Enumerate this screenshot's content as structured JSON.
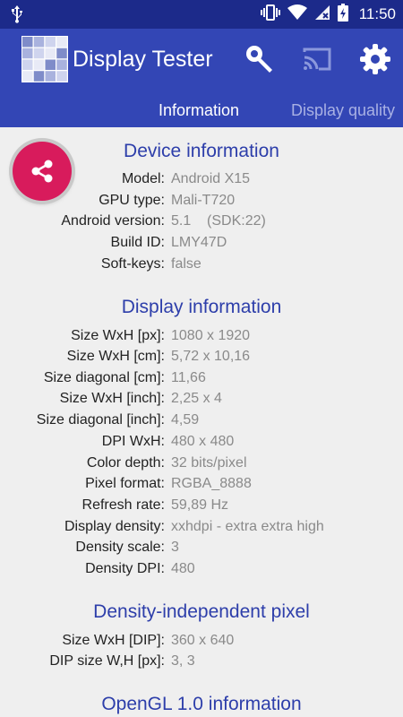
{
  "status_bar": {
    "time": "11:50",
    "icons": [
      "usb-icon",
      "vibrate-icon",
      "wifi-icon",
      "no-sim-icon",
      "battery-charging-icon"
    ]
  },
  "app": {
    "title": "Display Tester",
    "toolbar_icons": [
      "wrench-icon",
      "cast-icon",
      "settings-icon"
    ]
  },
  "tabs": [
    {
      "label": "Information",
      "active": true
    },
    {
      "label": "Display quality",
      "active": false
    }
  ],
  "share_button": {
    "icon": "share-icon",
    "color": "#d81b5c"
  },
  "sections": [
    {
      "title": "Device information",
      "rows": [
        {
          "label": "Model:",
          "value": "Android X15"
        },
        {
          "label": "GPU type:",
          "value": "Mali-T720"
        },
        {
          "label": "Android version:",
          "value": "5.1    (SDK:22)"
        },
        {
          "label": "Build ID:",
          "value": "LMY47D"
        },
        {
          "label": "Soft-keys:",
          "value": "false"
        }
      ]
    },
    {
      "title": "Display information",
      "rows": [
        {
          "label": "Size WxH [px]:",
          "value": "1080 x 1920"
        },
        {
          "label": "Size WxH [cm]:",
          "value": "5,72 x 10,16"
        },
        {
          "label": "Size diagonal [cm]:",
          "value": "11,66"
        },
        {
          "label": "Size WxH [inch]:",
          "value": "2,25 x 4"
        },
        {
          "label": "Size diagonal [inch]:",
          "value": "4,59"
        },
        {
          "label": "DPI WxH:",
          "value": "480 x 480"
        },
        {
          "label": "Color depth:",
          "value": "32 bits/pixel"
        },
        {
          "label": "Pixel format:",
          "value": "RGBA_8888"
        },
        {
          "label": "Refresh rate:",
          "value": "59,89 Hz"
        },
        {
          "label": "Display density:",
          "value": "xxhdpi - extra extra high"
        },
        {
          "label": "Density scale:",
          "value": "3"
        },
        {
          "label": "Density DPI:",
          "value": "480"
        }
      ]
    },
    {
      "title": "Density-independent pixel",
      "rows": [
        {
          "label": "Size WxH [DIP]:",
          "value": "360 x 640"
        },
        {
          "label": "DIP size W,H [px]:",
          "value": "3, 3"
        }
      ]
    },
    {
      "title": "OpenGL 1.0 information",
      "rows": []
    }
  ],
  "colors": {
    "status_bar": "#1c2a8a",
    "app_bar": "#3346b5",
    "section_title": "#2d3eaa",
    "background": "#efefef",
    "value_text": "#8a8a8a"
  }
}
